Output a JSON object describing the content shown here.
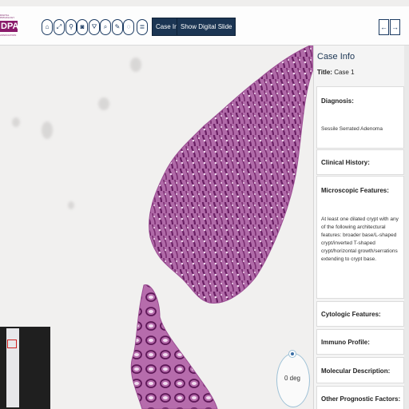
{
  "logo": {
    "top_small_text": "DIGITAL PATHOLOGY",
    "main_text": "DPA",
    "bottom_small_text": "ASSOCIATION",
    "brand_color": "#8a1a6a"
  },
  "toolbar": {
    "tool_icons": [
      "home-icon",
      "expand-icon",
      "zoom-icon",
      "camera-icon",
      "filter-icon",
      "draw-icon",
      "pen-icon",
      "rotate-icon",
      "list-icon"
    ],
    "tool_glyphs": [
      "⌂",
      "⤢",
      "⚲",
      "◙",
      "⛛",
      "⌕",
      "✎",
      "◌",
      "≣"
    ],
    "case_info_label": "Case Info",
    "show_slide_label": "Show Digital Slide",
    "prev_label": "←",
    "next_label": "→",
    "accent_color": "#1b3553"
  },
  "viewer": {
    "rotation_label": "0 deg"
  },
  "panel": {
    "title": "Case Info",
    "case_prefix": "Title:",
    "case_value": "Case 1",
    "sections": {
      "diagnosis": {
        "head": "Diagnosis:",
        "body": "Sessile Serrated Adenoma"
      },
      "clinical_history": {
        "head": "Clinical History:"
      },
      "microscopic": {
        "head": "Microscopic Features:",
        "body": "At least one dilated crypt with any of the following architectural features: broader base/L-shaped crypt/inverted T-shaped crypt/horizontal growth/serrations extending to crypt base."
      },
      "cytologic": {
        "head": "Cytologic Features:"
      },
      "immuno": {
        "head": "Immuno Profile:"
      },
      "molecular": {
        "head": "Molecular Description:"
      },
      "prognostic": {
        "head": "Other Prognostic Factors:"
      }
    }
  }
}
